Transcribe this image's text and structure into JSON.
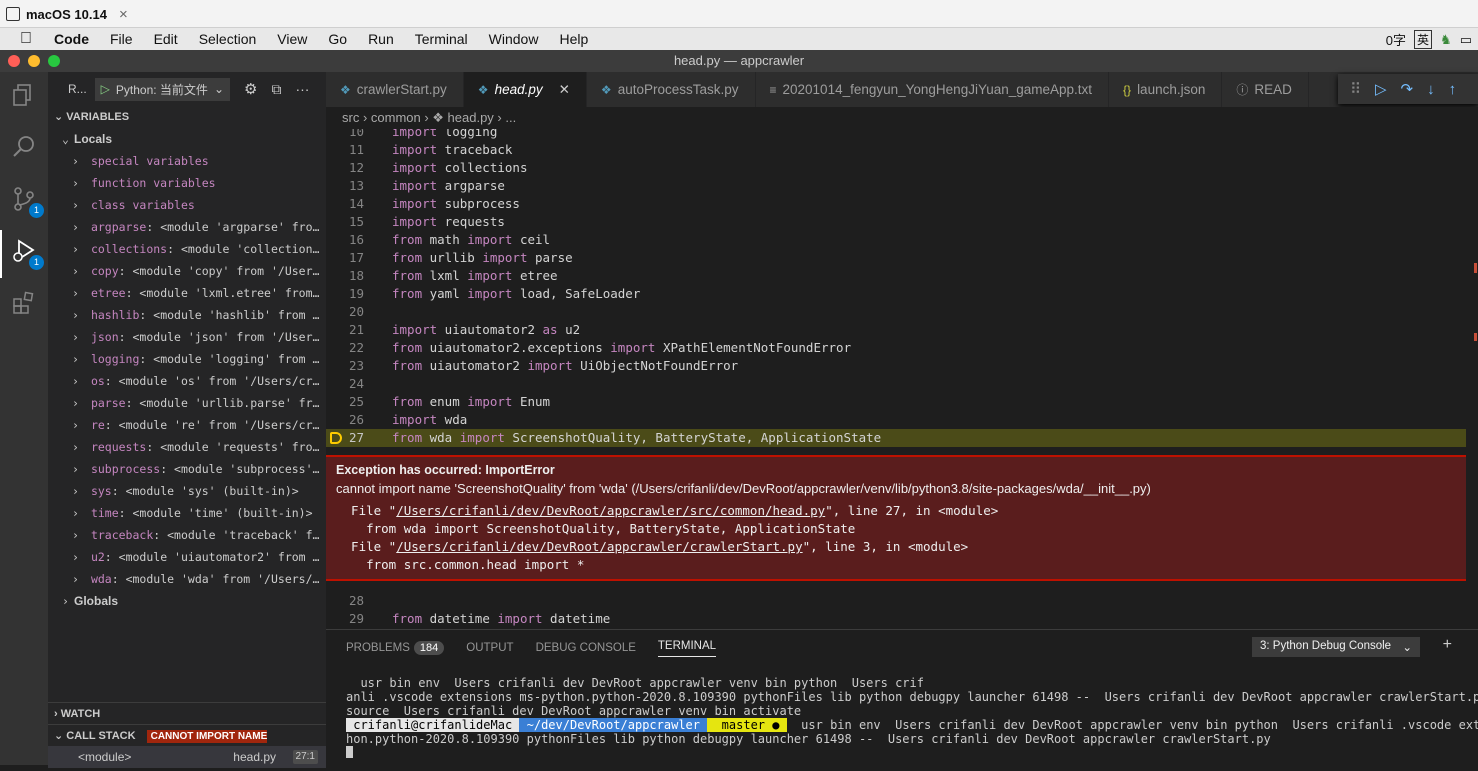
{
  "vm": {
    "title": "macOS 10.14",
    "close": "×"
  },
  "menubar": {
    "apple": "",
    "items": [
      "Code",
      "File",
      "Edit",
      "Selection",
      "View",
      "Go",
      "Run",
      "Terminal",
      "Window",
      "Help"
    ],
    "right_text": "0字",
    "ime": "英"
  },
  "window": {
    "title": "head.py — appcrawler"
  },
  "activity": {
    "scm_badge": "1",
    "debug_badge": "1"
  },
  "sidebar": {
    "run_label": "R...",
    "config": "Python: 当前文件",
    "variables_header": "VARIABLES",
    "locals": "Locals",
    "groups": [
      "special variables",
      "function variables",
      "class variables"
    ],
    "vars": [
      {
        "name": "argparse",
        "value": "<module 'argparse' from '..."
      },
      {
        "name": "collections",
        "value": "<module 'collections' ..."
      },
      {
        "name": "copy",
        "value": "<module 'copy' from '/Users/c..."
      },
      {
        "name": "etree",
        "value": "<module 'lxml.etree' from '/..."
      },
      {
        "name": "hashlib",
        "value": "<module 'hashlib' from '/U..."
      },
      {
        "name": "json",
        "value": "<module 'json' from '/Users/c..."
      },
      {
        "name": "logging",
        "value": "<module 'logging' from '/U..."
      },
      {
        "name": "os",
        "value": "<module 'os' from '/Users/crifa..."
      },
      {
        "name": "parse",
        "value": "<module 'urllib.parse' from ..."
      },
      {
        "name": "re",
        "value": "<module 're' from '/Users/crifa..."
      },
      {
        "name": "requests",
        "value": "<module 'requests' from '..."
      },
      {
        "name": "subprocess",
        "value": "<module 'subprocess' fr..."
      },
      {
        "name": "sys",
        "value": "<module 'sys' (built-in)>"
      },
      {
        "name": "time",
        "value": "<module 'time' (built-in)>"
      },
      {
        "name": "traceback",
        "value": "<module 'traceback' from..."
      },
      {
        "name": "u2",
        "value": "<module 'uiautomator2' from '/U..."
      },
      {
        "name": "wda",
        "value": "<module 'wda' from '/Users/cri..."
      }
    ],
    "globals": "Globals",
    "watch": "WATCH",
    "callstack": "CALL STACK",
    "callstack_badge": "CANNOT IMPORT NAME 'SCREENSH...",
    "frame": {
      "name": "<module>",
      "file": "head.py",
      "pos": "27:1"
    }
  },
  "tabs": [
    {
      "label": "crawlerStart.py",
      "icon": "python-icon",
      "glyph": "❖"
    },
    {
      "label": "head.py",
      "icon": "python-icon",
      "glyph": "❖",
      "active": true
    },
    {
      "label": "autoProcessTask.py",
      "icon": "python-icon",
      "glyph": "❖"
    },
    {
      "label": "20201014_fengyun_YongHengJiYuan_gameApp.txt",
      "icon": "text-icon",
      "glyph": "≡"
    },
    {
      "label": "launch.json",
      "icon": "json-icon",
      "glyph": "{}"
    },
    {
      "label": "READ",
      "icon": "info-icon",
      "glyph": "ⓘ"
    }
  ],
  "breadcrumb": {
    "text": "src  ›  common  ›  ❖ head.py  ›  ..."
  },
  "code": [
    {
      "n": "10",
      "t": "import logging"
    },
    {
      "n": "11",
      "t": "import traceback"
    },
    {
      "n": "12",
      "t": "import collections"
    },
    {
      "n": "13",
      "t": "import argparse"
    },
    {
      "n": "14",
      "t": "import subprocess"
    },
    {
      "n": "15",
      "t": "import requests"
    },
    {
      "n": "16",
      "t": "from math import ceil"
    },
    {
      "n": "17",
      "t": "from urllib import parse"
    },
    {
      "n": "18",
      "t": "from lxml import etree"
    },
    {
      "n": "19",
      "t": "from yaml import load, SafeLoader"
    },
    {
      "n": "20",
      "t": ""
    },
    {
      "n": "21",
      "t": "import uiautomator2 as u2"
    },
    {
      "n": "22",
      "t": "from uiautomator2.exceptions import XPathElementNotFoundError"
    },
    {
      "n": "23",
      "t": "from uiautomator2 import UiObjectNotFoundError"
    },
    {
      "n": "24",
      "t": ""
    },
    {
      "n": "25",
      "t": "from enum import Enum"
    },
    {
      "n": "26",
      "t": "import wda"
    },
    {
      "n": "27",
      "t": "from wda import ScreenshotQuality, BatteryState, ApplicationState"
    }
  ],
  "code_after": [
    {
      "n": "28",
      "t": ""
    },
    {
      "n": "29",
      "t": "from datetime import datetime"
    }
  ],
  "exception": {
    "title": "Exception has occurred: ImportError",
    "message": "cannot import name 'ScreenshotQuality' from 'wda' (/Users/crifanli/dev/DevRoot/appcrawler/venv/lib/python3.8/site-packages/wda/__init__.py)",
    "f1_pre": "  File \"",
    "f1_path": "/Users/crifanli/dev/DevRoot/appcrawler/src/common/head.py",
    "f1_post": "\", line 27, in <module>",
    "f1_code": "    from wda import ScreenshotQuality, BatteryState, ApplicationState",
    "f2_pre": "  File \"",
    "f2_path": "/Users/crifanli/dev/DevRoot/appcrawler/crawlerStart.py",
    "f2_post": "\", line 3, in <module>",
    "f2_code": "    from src.common.head import *"
  },
  "panel": {
    "problems": "PROBLEMS",
    "problems_count": "184",
    "output": "OUTPUT",
    "debug_console": "DEBUG CONSOLE",
    "terminal": "TERMINAL",
    "terminal_select": "3: Python Debug Console",
    "plus": "+"
  },
  "terminal": {
    "l1": "  usr bin env  Users crifanli dev DevRoot appcrawler venv bin python  Users crif",
    "l2": "anli .vscode extensions ms-python.python-2020.8.109390 pythonFiles lib python debugpy launcher 61498 --  Users crifanli dev DevRoot appcrawler crawlerStart.py",
    "l3": "source  Users crifanli dev DevRoot appcrawler venv bin activate",
    "user": " crifanli@crifanlideMac ",
    "dir": " ~/dev/DevRoot/appcrawler ",
    "git": "  master ● ",
    "l4_rest": "  usr bin env  Users crifanli dev DevRoot appcrawler venv bin python  Users crifanli .vscode ext",
    "l5": "hon.python-2020.8.109390 pythonFiles lib python debugpy launcher 61498 --  Users crifanli dev DevRoot appcrawler crawlerStart.py"
  }
}
